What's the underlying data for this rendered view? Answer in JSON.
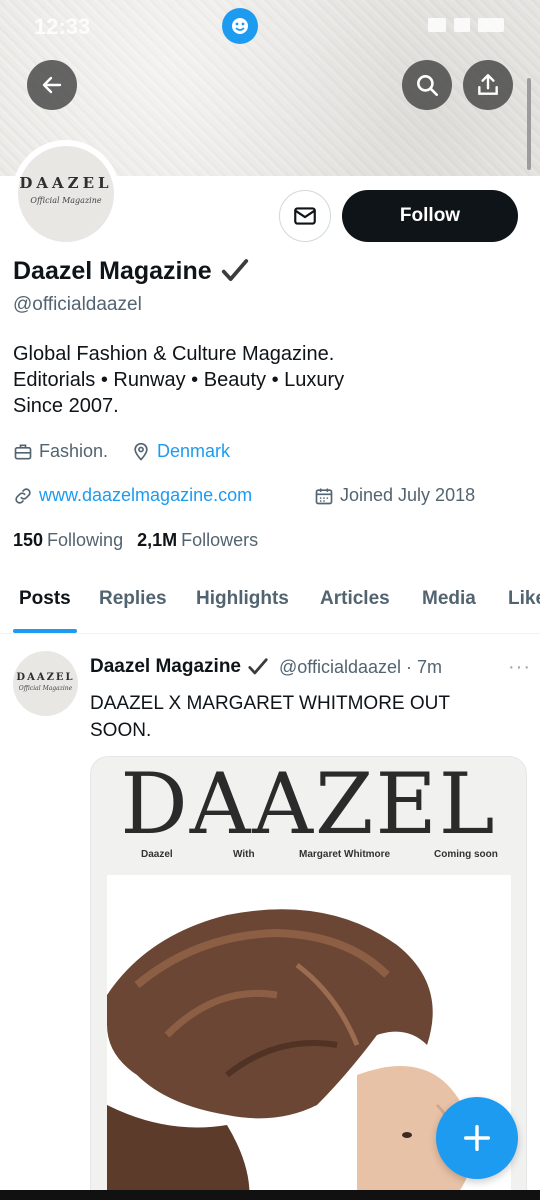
{
  "statusbar": {
    "time": "12:33"
  },
  "profile": {
    "display_name": "Daazel Magazine",
    "handle": "@officialdaazel",
    "avatar_logo": "DAAZEL",
    "avatar_script": "Official Magazine",
    "follow_label": "Follow",
    "bio": [
      "Global Fashion & Culture Magazine.",
      "Editorials • Runway • Beauty • Luxury",
      "Since 2007."
    ],
    "category": "Fashion.",
    "location": "Denmark",
    "website": "www.daazelmagazine.com",
    "joined": "Joined July 2018",
    "following_count": "150",
    "following_label": "Following",
    "followers_count": "2,1M",
    "followers_label": "Followers"
  },
  "tabs": [
    "Posts",
    "Replies",
    "Highlights",
    "Articles",
    "Media",
    "Likes"
  ],
  "post": {
    "name": "Daazel Magazine",
    "handle_time": "@officialdaazel · 7m",
    "more": "···",
    "text": "DAAZEL X MARGARET WHITMORE OUT SOON.",
    "media": {
      "title": "DAAZEL",
      "row": [
        "Daazel",
        "With",
        "Margaret Whitmore",
        "Coming soon"
      ]
    }
  },
  "icons": [
    "back-arrow-icon",
    "search-icon",
    "share-icon",
    "mail-icon",
    "verified-check-icon",
    "briefcase-icon",
    "location-pin-icon",
    "link-icon",
    "calendar-icon",
    "plus-icon"
  ],
  "colors": {
    "accent": "#1d9bf0",
    "text": "#0f1419",
    "secondary": "#536471",
    "follow_bg": "#0f1419"
  }
}
